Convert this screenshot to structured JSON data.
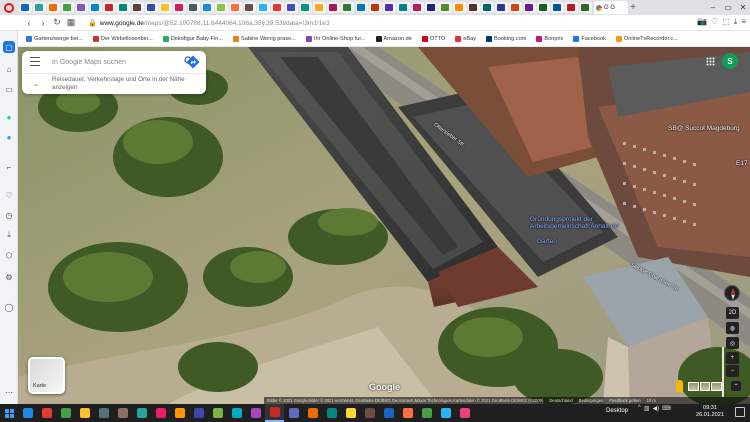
{
  "browser": {
    "active_tab_title": "G G",
    "url_host": "www.google.de",
    "url_path": "/maps/@52.100788,11.6444064,106a,35y,39.53t/data=!3m1!1e3"
  },
  "bookmarks": [
    {
      "label": "Gartenzwerge bei...",
      "color": "#2a7bd4"
    },
    {
      "label": "Der Wirbellosenbio...",
      "color": "#c0392b"
    },
    {
      "label": "Dekofigur Baby Fin...",
      "color": "#27ae60"
    },
    {
      "label": "Sabine Wenig prase...",
      "color": "#e67e22"
    },
    {
      "label": "Ihr Online-Shop fur...",
      "color": "#8e44ad"
    },
    {
      "label": "Amazon.de",
      "color": "#222222"
    },
    {
      "label": "OTTO",
      "color": "#d0021b"
    },
    {
      "label": "eBay",
      "color": "#e53238"
    },
    {
      "label": "Booking.com",
      "color": "#003580"
    },
    {
      "label": "Bonprix",
      "color": "#c7157c"
    },
    {
      "label": "Facebook",
      "color": "#1877f2"
    },
    {
      "label": "OnlineTvRecorder.c...",
      "color": "#f39c12"
    }
  ],
  "search": {
    "placeholder": "In Google Maps suchen",
    "travel_hint": "Reisedauer, Verkehrslage und Orte in der Nähe anzeigen"
  },
  "account": {
    "initial": "S",
    "color": "#0f9d58"
  },
  "map": {
    "labels": {
      "success": "SB@ Succot Magdeburg",
      "e17": "E17",
      "straße_upper": "Ottersleber Str.",
      "poi_blue": "Gründungsprojekt der Arbeitsgemeinschaft Anhalt eV",
      "poi_blue2": "Garten",
      "straße_lower": "Salbker Chaussee Str.",
      "google": "Google"
    },
    "layer_button": "Karte",
    "controls": {
      "tilt": "2D"
    },
    "attribution": [
      "Bilder © 2021 Google,Bilder © 2021 AeroWest, GeoBasis-DE/BKG,Geocontent,Maxar Technologies,Kartendaten © 2021 GeoBasis-DE/BKG (©2009)",
      "Deutschland",
      "Bedingungen",
      "Feedback geben",
      "10 m"
    ]
  },
  "taskbar": {
    "desktop_label": "Desktop",
    "time": "09:31",
    "date": "26.01.2021",
    "apps": [
      "#1e88e5",
      "#e53935",
      "#43a047",
      "#fbc02d",
      "#546e7a",
      "#8d6e63",
      "#26a69a",
      "#e91e63",
      "#ff9800",
      "#3949ab",
      "#7cb342",
      "#00acc1",
      "#ab47bc",
      "#c62828",
      "#5c6bc0",
      "#ef6c00",
      "#00897b",
      "#fdd835",
      "#6d4c41",
      "#1565c0",
      "#ff7043",
      "#43a047",
      "#29b6f6",
      "#ec407a"
    ]
  }
}
